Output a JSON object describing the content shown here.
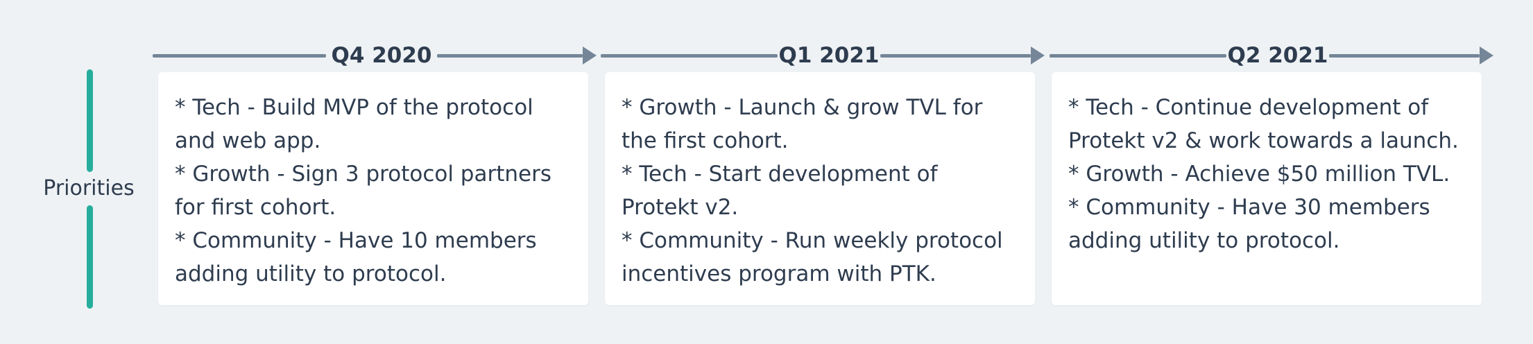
{
  "row_label": "Priorities",
  "columns": [
    {
      "title": "Q4 2020",
      "lines": [
        "* Tech - Build MVP of the protocol",
        "and web app.",
        "* Growth - Sign 3 protocol partners",
        "for first cohort.",
        "* Community - Have 10 members",
        "adding utility to protocol."
      ]
    },
    {
      "title": "Q1 2021",
      "lines": [
        "* Growth - Launch & grow TVL for",
        "the first cohort.",
        "* Tech - Start development of",
        "Protekt v2.",
        "* Community - Run weekly protocol",
        "incentives program with PTK."
      ]
    },
    {
      "title": "Q2 2021",
      "lines": [
        "* Tech - Continue development of",
        "Protekt v2 & work towards a launch.",
        "* Growth - Achieve $50 million TVL.",
        "* Community - Have 30 members",
        "adding utility to protocol."
      ]
    }
  ],
  "colors": {
    "background": "#eff2f5",
    "accent_bar": "#26ae9c",
    "arrow": "#748697",
    "card": "#ffffff",
    "text": "#2e3c4f"
  }
}
